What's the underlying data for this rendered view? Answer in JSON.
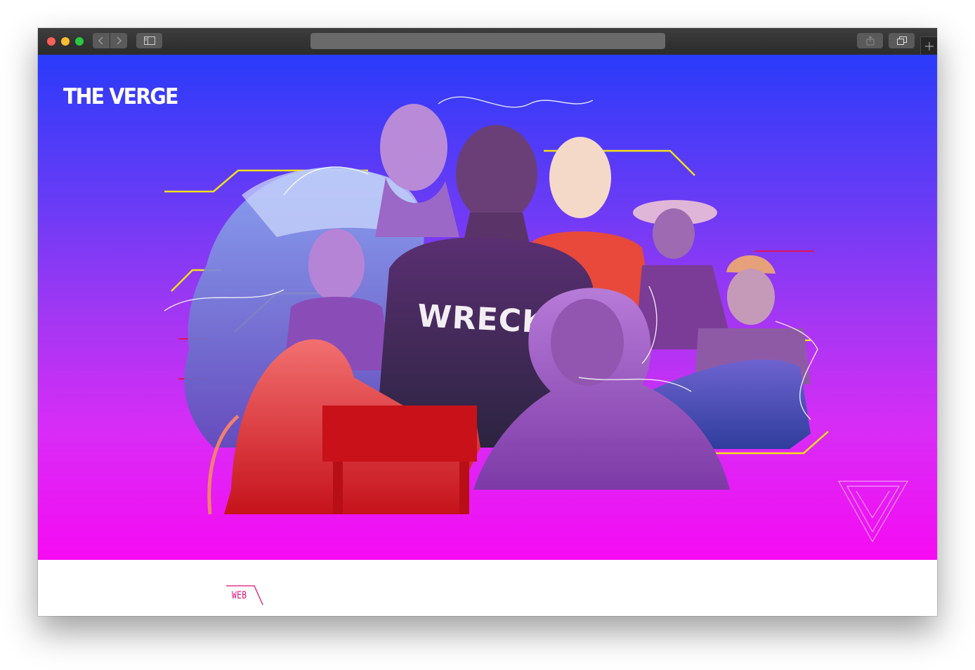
{
  "browser": {
    "window_controls": {
      "close": "close-light",
      "minimize": "minimize-light",
      "zoom": "zoom-light"
    },
    "toolbar": {
      "back_icon": "chevron-left-icon",
      "forward_icon": "chevron-right-icon",
      "sidebar_icon": "sidebar-icon",
      "share_icon": "share-icon",
      "tabs_icon": "tabs-overview-icon",
      "new_tab_icon": "plus-icon"
    },
    "address_bar": {
      "url": ""
    }
  },
  "hero": {
    "logo": "THE VERGE",
    "tshirt_text": "WRECKE",
    "corner_mark": "verge-triangle-icon",
    "gradient": {
      "top": "#2a3bfa",
      "middle": "#a337f3",
      "bottom": "#f60bf3"
    }
  },
  "article": {
    "section_label": "WEB",
    "accent_color": "#e2127a"
  }
}
